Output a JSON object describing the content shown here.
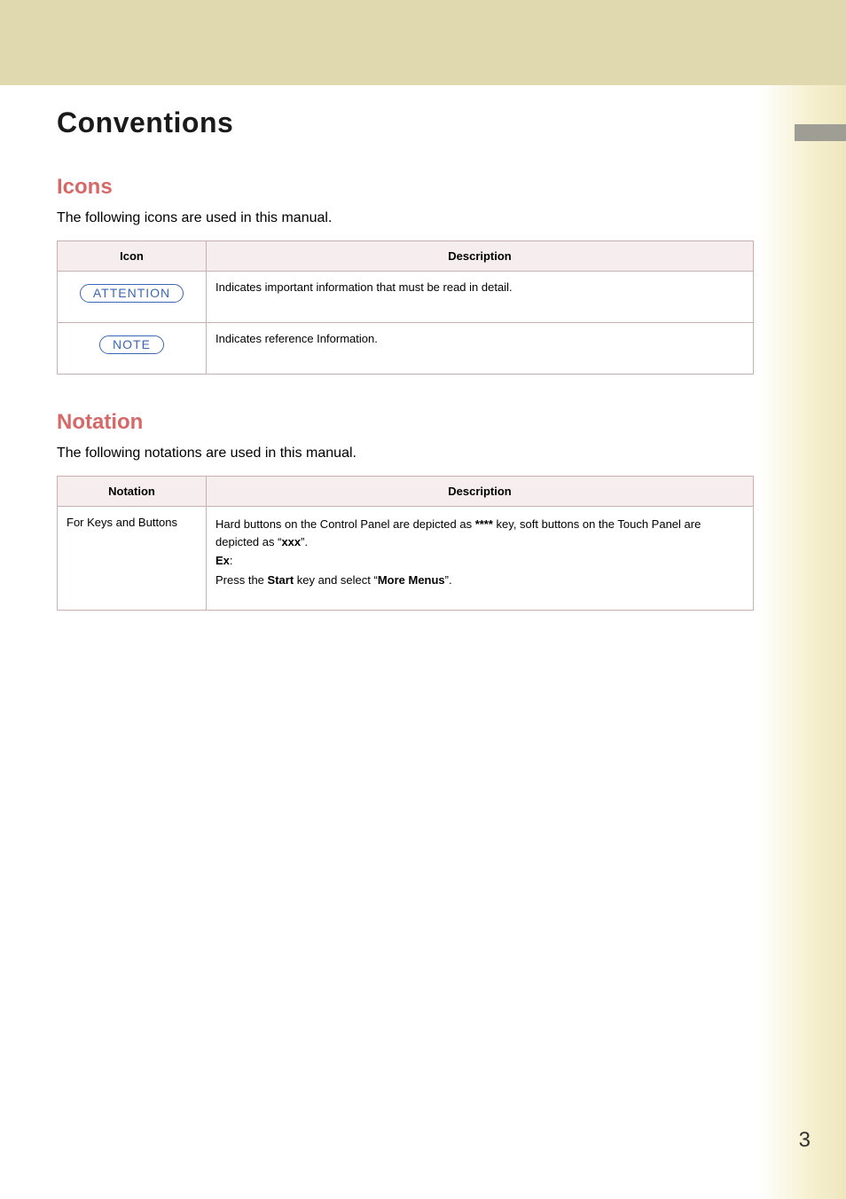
{
  "page_title": "Conventions",
  "sections": {
    "icons": {
      "heading": "Icons",
      "lead": "The following icons are used in this manual.",
      "cols": {
        "icon": "Icon",
        "description": "Description"
      },
      "rows": [
        {
          "icon_label": "ATTENTION",
          "description": "Indicates important information that must be read in detail."
        },
        {
          "icon_label": "NOTE",
          "description": "Indicates reference Information."
        }
      ]
    },
    "notation": {
      "heading": "Notation",
      "lead": "The following notations are used in this manual.",
      "cols": {
        "notation": "Notation",
        "description": "Description"
      },
      "rows": [
        {
          "notation": "For Keys and Buttons",
          "description": {
            "l1a": "Hard buttons on the Control Panel are depicted as ",
            "l1b": "****",
            "l1c": " key, soft buttons on the Touch Panel are depicted as “",
            "l1d": "xxx",
            "l1e": "”.",
            "l2a": "Ex",
            "l2b": ":",
            "l3a": "Press the ",
            "l3b": "Start",
            "l3c": " key and select “",
            "l3d": "More Menus",
            "l3e": "”."
          }
        }
      ]
    }
  },
  "page_number": "3"
}
